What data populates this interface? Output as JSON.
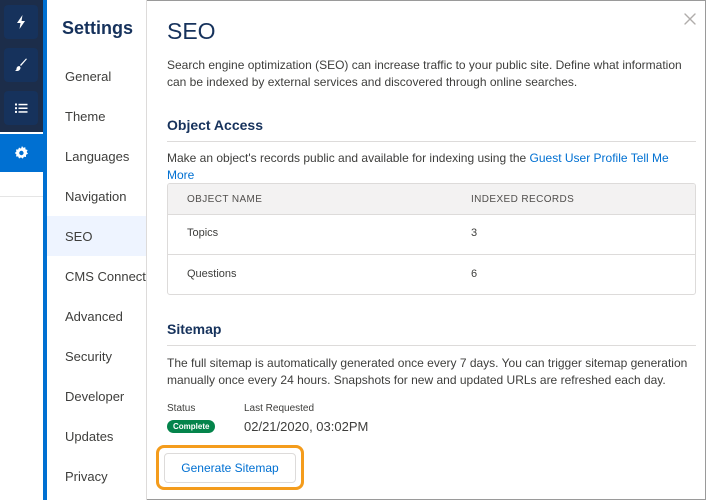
{
  "rail": {
    "icons": [
      "lightning-icon",
      "brush-icon",
      "list-icon",
      "gear-icon"
    ]
  },
  "nav": {
    "title": "Settings",
    "items": [
      {
        "label": "General"
      },
      {
        "label": "Theme"
      },
      {
        "label": "Languages"
      },
      {
        "label": "Navigation"
      },
      {
        "label": "SEO",
        "active": true
      },
      {
        "label": "CMS Connect"
      },
      {
        "label": "Advanced"
      },
      {
        "label": "Security"
      },
      {
        "label": "Developer"
      },
      {
        "label": "Updates"
      },
      {
        "label": "Privacy"
      }
    ]
  },
  "main": {
    "title": "SEO",
    "intro_line1": "Search engine optimization (SEO) can increase traffic to your public site. Define what information",
    "intro_line2": "can be indexed by external services and discovered through online searches.",
    "object_access": {
      "heading": "Object Access",
      "text": "Make an object's records public and available for indexing using the ",
      "link": "Guest User Profile",
      "tell_me_more": "Tell Me More",
      "table": {
        "columns": [
          "OBJECT NAME",
          "INDEXED RECORDS"
        ],
        "rows": [
          [
            "Topics",
            "3"
          ],
          [
            "Questions",
            "6"
          ]
        ]
      }
    },
    "sitemap": {
      "heading": "Sitemap",
      "text_line1": "The full sitemap is automatically generated once every 7 days. You can trigger sitemap generation",
      "text_line2": "manually once every 24 hours. Snapshots for new and updated URLs are refreshed each day.",
      "status_label": "Status",
      "last_requested_label": "Last Requested",
      "status": "Complete",
      "last_requested": "02/21/2020, 03:02PM",
      "button": "Generate Sitemap"
    }
  },
  "colors": {
    "accent": "#0070d2",
    "rail_dark": "#16325c",
    "status_green": "#04844b",
    "highlight_orange": "#f49c1c"
  }
}
